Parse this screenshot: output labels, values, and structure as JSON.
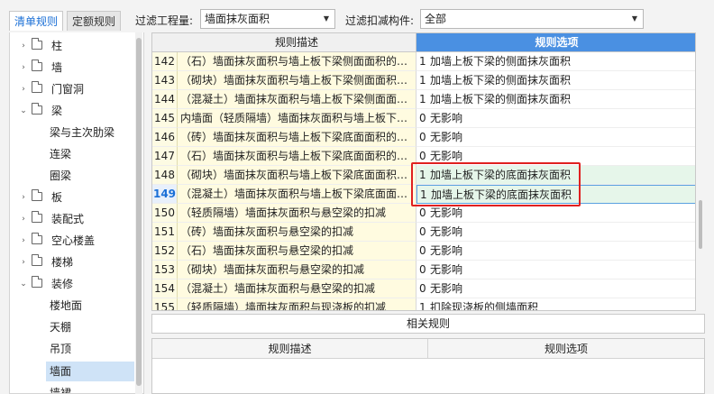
{
  "tabs": {
    "active": "清单规则",
    "inactive": "定额规则"
  },
  "filters": {
    "quantity_label": "过滤工程量:",
    "quantity_value": "墙面抹灰面积",
    "deduct_label": "过滤扣减构件:",
    "deduct_value": "全部"
  },
  "tree": {
    "items": [
      {
        "label": "柱",
        "expander": "›"
      },
      {
        "label": "墙",
        "expander": "›"
      },
      {
        "label": "门窗洞",
        "expander": "›"
      },
      {
        "label": "梁",
        "expander": "⌄"
      },
      {
        "label": "板",
        "expander": "›"
      },
      {
        "label": "装配式",
        "expander": "›"
      },
      {
        "label": "空心楼盖",
        "expander": "›"
      },
      {
        "label": "楼梯",
        "expander": "›"
      },
      {
        "label": "装修",
        "expander": "⌄"
      }
    ],
    "beam_children": [
      "梁与主次肋梁",
      "连梁",
      "圈梁"
    ],
    "decor_children": [
      "楼地面",
      "天棚",
      "吊顶",
      "墙面",
      "墙裙"
    ]
  },
  "grid": {
    "col_desc": "规则描述",
    "col_opt": "规则选项",
    "rows": [
      {
        "n": "142",
        "desc": "（石）墙面抹灰面积与墙上板下梁侧面面积的…",
        "code": "1",
        "opt": "加墙上板下梁的侧面抹灰面积"
      },
      {
        "n": "143",
        "desc": "（砌块）墙面抹灰面积与墙上板下梁侧面面积…",
        "code": "1",
        "opt": "加墙上板下梁的侧面抹灰面积"
      },
      {
        "n": "144",
        "desc": "（混凝土）墙面抹灰面积与墙上板下梁侧面面…",
        "code": "1",
        "opt": "加墙上板下梁的侧面抹灰面积"
      },
      {
        "n": "145",
        "desc": "内墙面（轻质隔墙）墙面抹灰面积与墙上板下…",
        "code": "0",
        "opt": "无影响"
      },
      {
        "n": "146",
        "desc": "（砖）墙面抹灰面积与墙上板下梁底面面积的…",
        "code": "0",
        "opt": "无影响"
      },
      {
        "n": "147",
        "desc": "（石）墙面抹灰面积与墙上板下梁底面面积的…",
        "code": "0",
        "opt": "无影响"
      },
      {
        "n": "148",
        "desc": "（砌块）墙面抹灰面积与墙上板下梁底面面积…",
        "code": "1",
        "opt": "加墙上板下梁的底面抹灰面积"
      },
      {
        "n": "149",
        "desc": "（混凝土）墙面抹灰面积与墙上板下梁底面面…",
        "code": "1",
        "opt": "加墙上板下梁的底面抹灰面积"
      },
      {
        "n": "150",
        "desc": "（轻质隔墙）墙面抹灰面积与悬空梁的扣减",
        "code": "0",
        "opt": "无影响"
      },
      {
        "n": "151",
        "desc": "（砖）墙面抹灰面积与悬空梁的扣减",
        "code": "0",
        "opt": "无影响"
      },
      {
        "n": "152",
        "desc": "（石）墙面抹灰面积与悬空梁的扣减",
        "code": "0",
        "opt": "无影响"
      },
      {
        "n": "153",
        "desc": "（砌块）墙面抹灰面积与悬空梁的扣减",
        "code": "0",
        "opt": "无影响"
      },
      {
        "n": "154",
        "desc": "（混凝土）墙面抹灰面积与悬空梁的扣减",
        "code": "0",
        "opt": "无影响"
      },
      {
        "n": "155",
        "desc": "（轻质隔墙）墙面抹灰面积与现浇板的扣减",
        "code": "1",
        "opt": "扣除现浇板的侧墙面积"
      }
    ]
  },
  "related": {
    "title": "相关规则",
    "col_desc": "规则描述",
    "col_opt": "规则选项"
  }
}
